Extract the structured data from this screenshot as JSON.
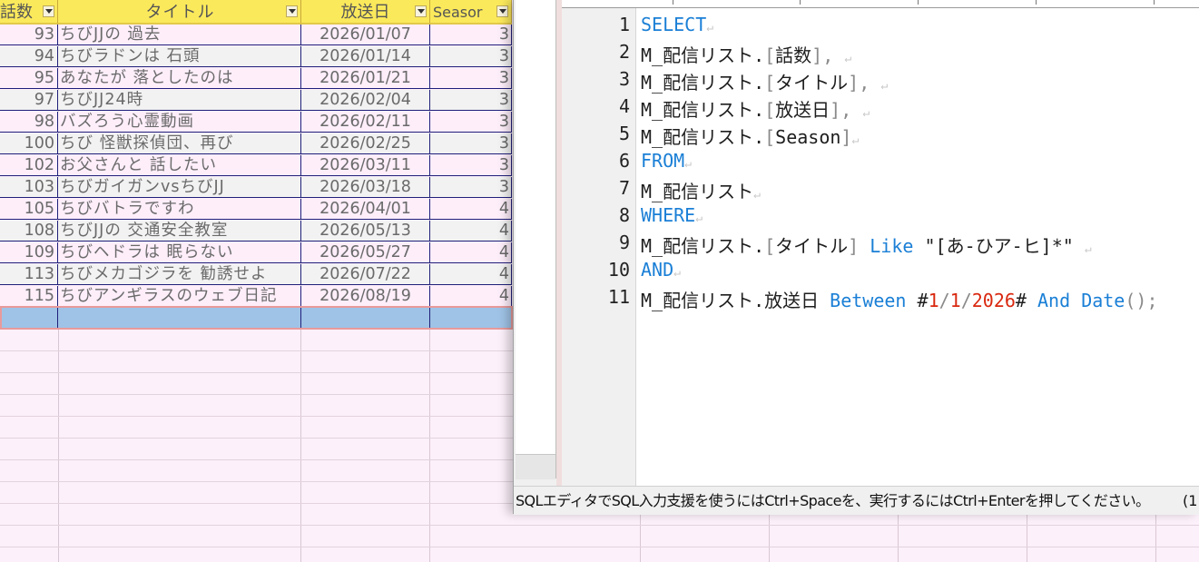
{
  "table": {
    "headers": [
      "話数",
      "タイトル",
      "放送日",
      "Seasor"
    ],
    "rows": [
      [
        "93",
        "ちびJJの 過去",
        "2026/01/07",
        "3"
      ],
      [
        "94",
        "ちびラドンは 石頭",
        "2026/01/14",
        "3"
      ],
      [
        "95",
        "あなたが 落としたのは",
        "2026/01/21",
        "3"
      ],
      [
        "97",
        "ちびJJ24時",
        "2026/02/04",
        "3"
      ],
      [
        "98",
        "バズろう心霊動画",
        "2026/02/11",
        "3"
      ],
      [
        "100",
        "ちび 怪獣探偵団、再び",
        "2026/02/25",
        "3"
      ],
      [
        "102",
        "お父さんと 話したい",
        "2026/03/11",
        "3"
      ],
      [
        "103",
        "ちびガイガンvsちびJJ",
        "2026/03/18",
        "3"
      ],
      [
        "105",
        "ちびバトラですわ",
        "2026/04/01",
        "4"
      ],
      [
        "108",
        "ちびJJの 交通安全教室",
        "2026/05/13",
        "4"
      ],
      [
        "109",
        "ちびヘドラは 眠らない",
        "2026/05/27",
        "4"
      ],
      [
        "113",
        "ちびメカゴジラを 勧誘せよ",
        "2026/07/22",
        "4"
      ],
      [
        "115",
        "ちびアンギラスのウェブ日記",
        "2026/08/19",
        "4"
      ]
    ]
  },
  "editor": {
    "line_numbers": [
      "1",
      "2",
      "3",
      "4",
      "5",
      "6",
      "7",
      "8",
      "9",
      "10",
      "11"
    ],
    "lines": {
      "l1": {
        "kw": "SELECT"
      },
      "l2": {
        "a": "M_配信リスト.",
        "b": "[",
        "c": "話数",
        "d": "],"
      },
      "l3": {
        "a": "M_配信リスト.",
        "b": "[",
        "c": "タイトル",
        "d": "],"
      },
      "l4": {
        "a": "M_配信リスト.",
        "b": "[",
        "c": "放送日",
        "d": "],"
      },
      "l5": {
        "a": "M_配信リスト.",
        "b": "[",
        "c": "Season",
        "d": "]"
      },
      "l6": {
        "kw": "FROM"
      },
      "l7": {
        "a": "M_配信リスト"
      },
      "l8": {
        "kw": "WHERE"
      },
      "l9": {
        "a": "M_配信リスト.",
        "b": "[",
        "c": "タイトル",
        "d": "]",
        "kw": "Like",
        "e": "\"[あ-ひア-ヒ]*\""
      },
      "l10": {
        "kw": "AND"
      },
      "l11": {
        "a": "M_配信リスト.放送日",
        "kw1": "Between",
        "h": "#",
        "n1": "1",
        "s1": "/",
        "n2": "1",
        "s2": "/",
        "n3": "2026",
        "h2": "#",
        "kw2": "And",
        "kw3": "Date",
        "p": "();"
      }
    },
    "return_mark": "↵",
    "status_message": "SQLエディタでSQL入力支援を使うにはCtrl+Spaceを、実行するにはCtrl+Enterを押してください。",
    "status_position": "(1"
  },
  "colors": {
    "keyword": "#1a7fd6",
    "number": "#d9280f",
    "header_fill": "#fbe95c",
    "selected_row": "#9fc3e6"
  }
}
